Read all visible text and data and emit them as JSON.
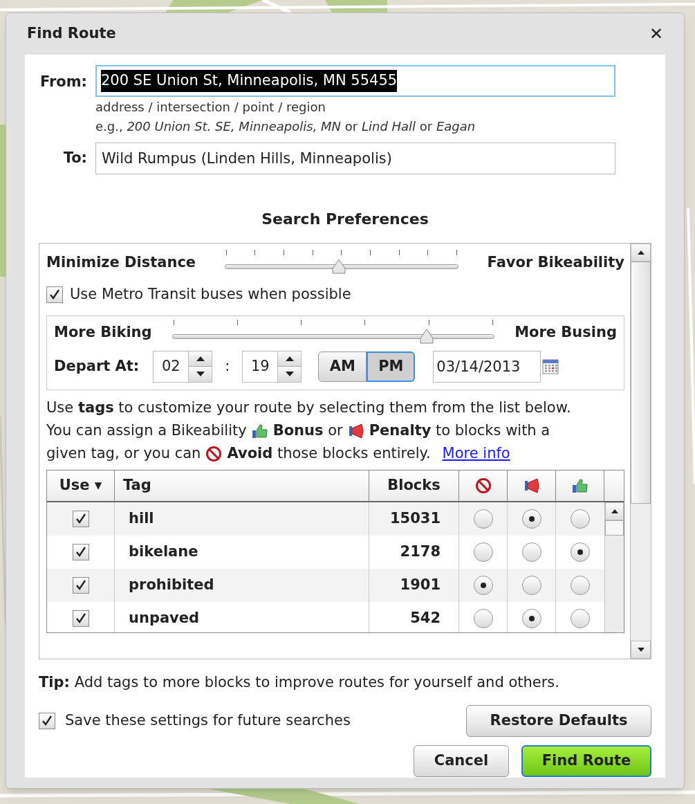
{
  "window": {
    "title": "Find Route",
    "close": "✕"
  },
  "from": {
    "label": "From:",
    "value": "200 SE Union St, Minneapolis, MN 55455",
    "hints": [
      "address / intersection / point / region",
      "e.g., *200 Union St. SE, Minneapolis, MN* or *Lind Hall* or *Eagan*"
    ]
  },
  "to": {
    "label": "To:",
    "value": "Wild Rumpus (Linden Hills, Minneapolis)"
  },
  "heading": "Search Preferences",
  "distance_slider": {
    "left_label": "Minimize Distance",
    "right_label": "Favor Bikeability",
    "level": 0.49
  },
  "transit": {
    "label": "Use Metro Transit buses when possible",
    "checked": true
  },
  "bus_slider": {
    "left_label": "More Biking",
    "right_label": "More Busing",
    "level": 0.79
  },
  "depart": {
    "label": "Depart At:",
    "hour": "02",
    "separator": ":",
    "minute": "19",
    "periods": [
      {
        "label": "AM",
        "selected": false
      },
      {
        "label": "PM",
        "selected": true
      }
    ],
    "date": "03/14/2013"
  },
  "intro": [
    [
      {
        "kind": "text",
        "text": "Use **tags** to customize your route by selecting them from the list below."
      }
    ],
    [
      {
        "kind": "text",
        "text": "You can assign a Bikeability"
      },
      {
        "kind": "bonus"
      },
      {
        "kind": "text",
        "text": "**Bonus** or"
      },
      {
        "kind": "penalty"
      },
      {
        "kind": "text",
        "text": "**Penalty** to blocks with a"
      }
    ],
    [
      {
        "kind": "text",
        "text": "given tag, or you can"
      },
      {
        "kind": "avoid"
      },
      {
        "kind": "text",
        "text": "**Avoid** those blocks entirely."
      },
      {
        "kind": "link",
        "text": "More info"
      }
    ]
  ],
  "table": {
    "columns": [
      {
        "kind": "text",
        "label": "Use ▾"
      },
      {
        "kind": "text",
        "label": "Tag"
      },
      {
        "kind": "text",
        "label": "Blocks"
      },
      {
        "kind": "avoid"
      },
      {
        "kind": "penalty"
      },
      {
        "kind": "bonus"
      }
    ],
    "rows": [
      {
        "checked": true,
        "tag": "hill",
        "blocks": "15031",
        "avoid": false,
        "penalty": true,
        "bonus": false
      },
      {
        "checked": true,
        "tag": "bikelane",
        "blocks": "2178",
        "avoid": false,
        "penalty": false,
        "bonus": true
      },
      {
        "checked": true,
        "tag": "prohibited",
        "blocks": "1901",
        "avoid": true,
        "penalty": false,
        "bonus": false
      },
      {
        "checked": true,
        "tag": "unpaved",
        "blocks": "542",
        "avoid": false,
        "penalty": true,
        "bonus": false
      }
    ]
  },
  "tip": "**Tip:** Add tags to more blocks to improve routes for yourself and others.",
  "save": {
    "label": "Save these settings for future searches",
    "checked": true
  },
  "buttons": [
    {
      "kind": "plain",
      "label": "Restore Defaults"
    },
    {
      "kind": "plain",
      "label": "Cancel"
    },
    {
      "kind": "primary",
      "label": "Find Route"
    }
  ]
}
